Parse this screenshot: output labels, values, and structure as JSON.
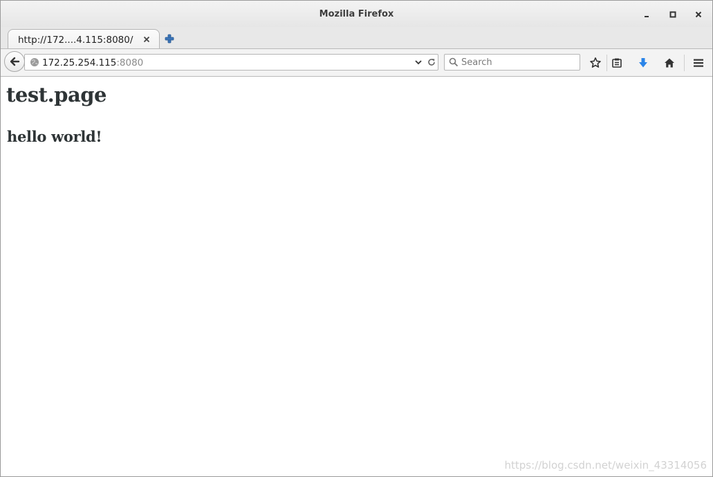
{
  "window": {
    "title": "Mozilla Firefox"
  },
  "tabs": [
    {
      "label": "http://172....4.115:8080/"
    }
  ],
  "urlbar": {
    "host": "172.25.254.115",
    "port": ":8080"
  },
  "search": {
    "placeholder": "Search"
  },
  "page": {
    "heading": "test.page",
    "subheading": "hello world!"
  },
  "watermark": "https://blog.csdn.net/weixin_43314056",
  "icons": {
    "minimize": "minimize-icon",
    "maximize": "maximize-icon",
    "close": "close-icon",
    "back": "back-arrow-icon",
    "globe": "globe-icon",
    "dropdown": "chevron-down-icon",
    "reload": "reload-icon",
    "search": "search-icon",
    "bookmark": "star-icon",
    "reading_list": "clipboard-icon",
    "downloads": "download-arrow-icon",
    "home": "home-icon",
    "menu": "hamburger-menu-icon",
    "new_tab": "plus-icon"
  },
  "colors": {
    "download_accent": "#2a84e8",
    "text": "#2e3436",
    "port_text": "#8a8a8a"
  }
}
